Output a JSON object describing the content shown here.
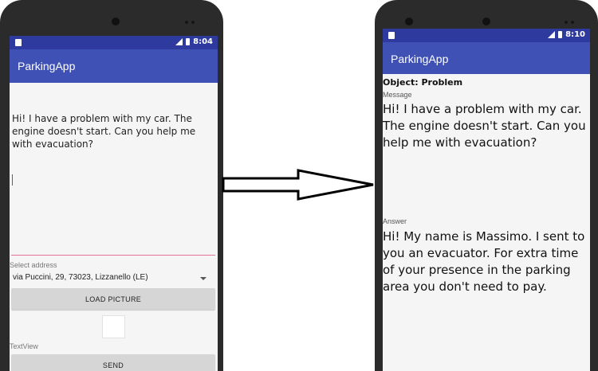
{
  "left_phone": {
    "status": {
      "time": "8:04",
      "network": "LTE"
    },
    "app_title": "ParkingApp",
    "message_text": "Hi! I have a problem with my car. The engine doesn't start. Can you help me with evacuation?",
    "select_address_label": "Select address",
    "address_value": "via Puccini, 29, 73023, Lizzanello (LE)",
    "load_picture_label": "LOAD PICTURE",
    "textview_label": "TextView",
    "send_label": "SEND"
  },
  "right_phone": {
    "status": {
      "time": "8:10",
      "network": "LTE"
    },
    "app_title": "ParkingApp",
    "object_line": "Object: Problem",
    "message_label": "Message",
    "message_text": "Hi! I have a problem with my car. The engine doesn't start. Can you help me with evacuation?",
    "answer_label": "Answer",
    "answer_text": "Hi! My name is Massimo. I sent to you an evacuator. For extra time of your presence in the parking area you don't need to pay."
  },
  "colors": {
    "status_bar": "#2f3a9e",
    "app_bar": "#3f51b5",
    "accent": "#e91e63",
    "screen_bg": "#f5f5f5"
  }
}
